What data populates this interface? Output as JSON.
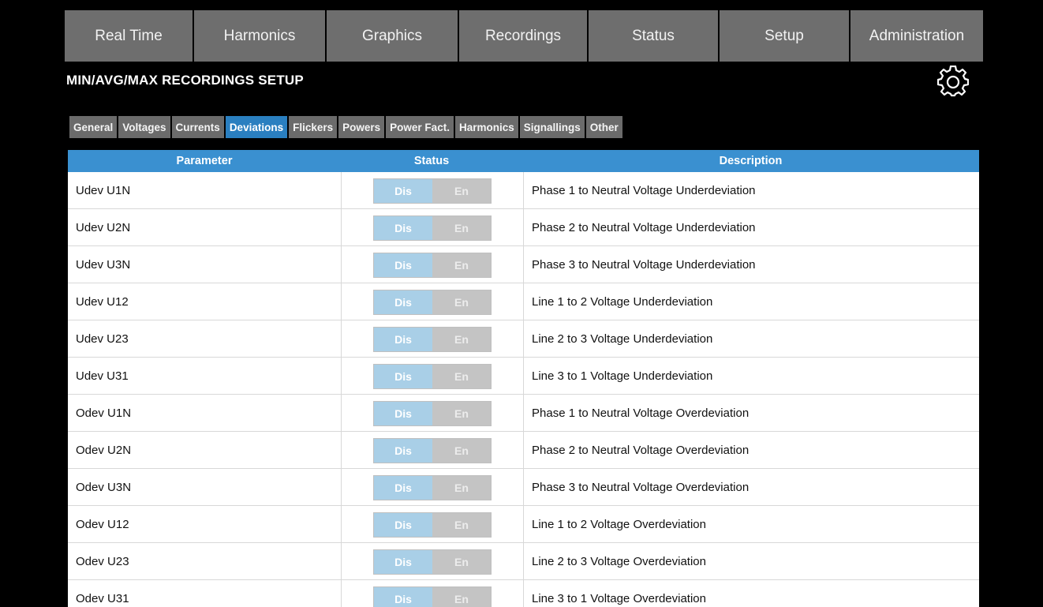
{
  "topnav": {
    "items": [
      {
        "label": "Real Time"
      },
      {
        "label": "Harmonics"
      },
      {
        "label": "Graphics"
      },
      {
        "label": "Recordings"
      },
      {
        "label": "Status"
      },
      {
        "label": "Setup"
      },
      {
        "label": "Administration"
      }
    ]
  },
  "page": {
    "title": "MIN/AVG/MAX RECORDINGS SETUP",
    "settings_icon": "gear-icon"
  },
  "subtabs": {
    "active": "Deviations",
    "items": [
      {
        "label": "General"
      },
      {
        "label": "Voltages"
      },
      {
        "label": "Currents"
      },
      {
        "label": "Deviations"
      },
      {
        "label": "Flickers"
      },
      {
        "label": "Powers"
      },
      {
        "label": "Power Fact."
      },
      {
        "label": "Harmonics"
      },
      {
        "label": "Signallings"
      },
      {
        "label": "Other"
      }
    ]
  },
  "table": {
    "headers": {
      "parameter": "Parameter",
      "status": "Status",
      "description": "Description"
    },
    "toggle_labels": {
      "off": "Dis",
      "on": "En"
    },
    "rows": [
      {
        "parameter": "Udev U1N",
        "status": "Dis",
        "description": "Phase 1 to Neutral Voltage Underdeviation"
      },
      {
        "parameter": "Udev U2N",
        "status": "Dis",
        "description": "Phase 2 to Neutral Voltage Underdeviation"
      },
      {
        "parameter": "Udev U3N",
        "status": "Dis",
        "description": "Phase 3 to Neutral Voltage Underdeviation"
      },
      {
        "parameter": "Udev U12",
        "status": "Dis",
        "description": "Line 1 to 2 Voltage Underdeviation"
      },
      {
        "parameter": "Udev U23",
        "status": "Dis",
        "description": "Line 2 to 3 Voltage Underdeviation"
      },
      {
        "parameter": "Udev U31",
        "status": "Dis",
        "description": "Line 3 to 1 Voltage Underdeviation"
      },
      {
        "parameter": "Odev U1N",
        "status": "Dis",
        "description": "Phase 1 to Neutral Voltage Overdeviation"
      },
      {
        "parameter": "Odev U2N",
        "status": "Dis",
        "description": "Phase 2 to Neutral Voltage Overdeviation"
      },
      {
        "parameter": "Odev U3N",
        "status": "Dis",
        "description": "Phase 3 to Neutral Voltage Overdeviation"
      },
      {
        "parameter": "Odev U12",
        "status": "Dis",
        "description": "Line 1 to 2 Voltage Overdeviation"
      },
      {
        "parameter": "Odev U23",
        "status": "Dis",
        "description": "Line 2 to 3 Voltage Overdeviation"
      },
      {
        "parameter": "Odev U31",
        "status": "Dis",
        "description": "Line 3 to 1 Voltage Overdeviation"
      }
    ]
  },
  "colors": {
    "nav_bg": "#6e6e6e",
    "active_tab": "#2a7fc0",
    "table_header": "#3a90d0",
    "toggle_dis": "#a9cfe7",
    "toggle_en": "#c4c4c4"
  }
}
